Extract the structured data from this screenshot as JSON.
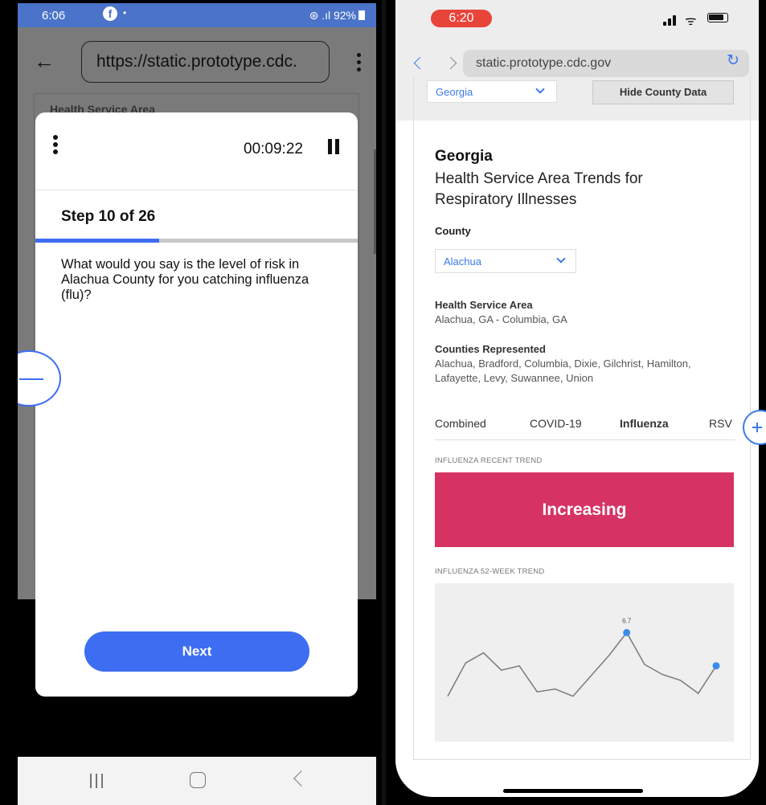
{
  "android": {
    "status": {
      "time": "6:06",
      "app_icon": "facebook-icon",
      "dot": "•",
      "signal": "⊛ .ıl",
      "battery": "92%"
    },
    "browser": {
      "url": "https://static.prototype.cdc.",
      "bg_text": "Health Service Area"
    },
    "modal": {
      "timer": "00:09:22",
      "step": "Step 10 of 26",
      "progress_fraction": 0.3846,
      "question": "What would you say is the level of risk in Alachua County for you catching influenza (flu)?",
      "next_label": "Next"
    },
    "accent_color": "#3d6ef2"
  },
  "iphone": {
    "status": {
      "time": "6:20"
    },
    "browser": {
      "url": "static.prototype.cdc.gov"
    },
    "state_select": "Georgia",
    "hide_county_button": "Hide County Data",
    "state_title": "Georgia",
    "subtitle": "Health Service Area Trends for Respiratory Illnesses",
    "county_label": "County",
    "county_select": "Alachua",
    "hsa_heading": "Health Service Area",
    "hsa_value": "Alachua, GA - Columbia, GA",
    "counties_heading": "Counties Represented",
    "counties_value": "Alachua, Bradford, Columbia, Dixie, Gilchrist, Hamilton, Lafayette, Levy, Suwannee, Union",
    "tabs": [
      "Combined",
      "COVID-19",
      "Influenza",
      "RSV"
    ],
    "active_tab": "Influenza",
    "recent_trend_caption": "INFLUENZA RECENT TREND",
    "recent_trend_value": "Increasing",
    "recent_trend_color": "#d63364",
    "week52_caption": "INFLUENZA 52-WEEK TREND",
    "accent_color": "#3b7ae8"
  },
  "chart_data": {
    "type": "line",
    "title": "",
    "xlabel": "",
    "ylabel": "",
    "ylim": [
      0,
      10
    ],
    "values": [
      2.3,
      4.6,
      5.3,
      4.1,
      4.4,
      2.6,
      2.8,
      2.3,
      3.7,
      5.1,
      6.7,
      4.5,
      3.8,
      3.4,
      2.5,
      4.4
    ],
    "labeled_point": {
      "index": 10,
      "label": "6.7"
    },
    "marker_indices": [
      10,
      15
    ],
    "line_color": "#7a7a7a",
    "marker_color": "#3b8ee8"
  }
}
